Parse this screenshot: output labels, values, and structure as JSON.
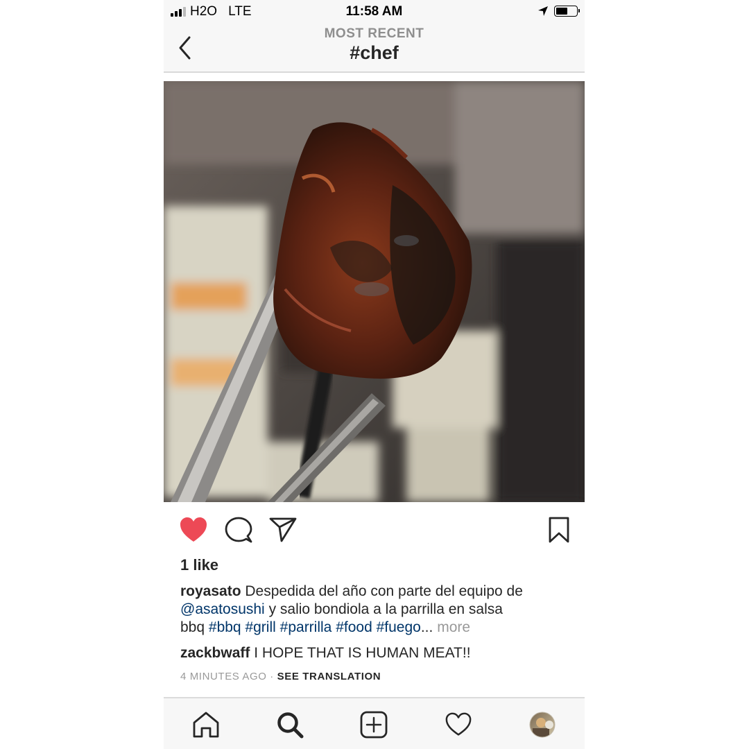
{
  "status_bar": {
    "carrier": "H2O",
    "network": "LTE",
    "time": "11:58 AM",
    "location_icon": "location-arrow-icon",
    "battery_icon": "battery-icon"
  },
  "header": {
    "subtitle": "MOST RECENT",
    "title": "#chef",
    "back_icon": "chevron-left-icon"
  },
  "post": {
    "image_icon": "grilled-meat-photo",
    "liked": true,
    "actions": [
      "heart-icon",
      "comment-icon",
      "share-icon",
      "bookmark-icon"
    ],
    "likes": "1 like",
    "caption": {
      "username": "royasato",
      "text1": "Despedida del año con parte del equipo de",
      "mention": "@asatosushi",
      "text2": "y salio bondiola a la parrilla en salsa",
      "text3": "bbq",
      "tags": [
        "#bbq",
        "#grill",
        "#parrilla",
        "#food",
        "#fuego"
      ],
      "ellipsis": "...",
      "more": "more"
    },
    "comment": {
      "username": "zackbwaff",
      "text": "I HOPE THAT IS HUMAN MEAT!!"
    },
    "time_ago": "4 MINUTES AGO",
    "separator": "·",
    "see_translation": "SEE TRANSLATION"
  },
  "colors": {
    "heart": "#ed4956",
    "link": "#003569",
    "muted": "#999999"
  },
  "tab_bar": {
    "items": [
      "home-icon",
      "search-icon",
      "add-post-icon",
      "activity-heart-icon",
      "profile-avatar"
    ],
    "active": "search-icon"
  }
}
